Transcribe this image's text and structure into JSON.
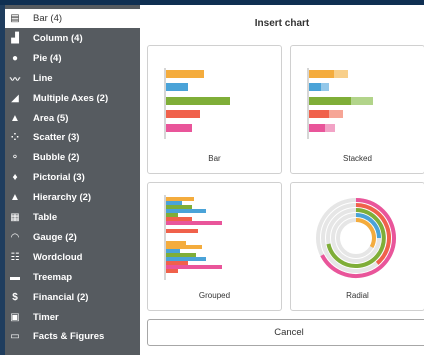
{
  "sidebar": {
    "items": [
      {
        "label": "Bar (4)",
        "icon": "bar-chart-icon",
        "glyph": "▤",
        "active": true
      },
      {
        "label": "Column (4)",
        "icon": "column-chart-icon",
        "glyph": "▟",
        "active": false
      },
      {
        "label": "Pie (4)",
        "icon": "pie-chart-icon",
        "glyph": "●",
        "active": false
      },
      {
        "label": "Line",
        "icon": "line-chart-icon",
        "glyph": "〰",
        "active": false
      },
      {
        "label": "Multiple Axes (2)",
        "icon": "multiple-axes-icon",
        "glyph": "◢",
        "active": false
      },
      {
        "label": "Area (5)",
        "icon": "area-chart-icon",
        "glyph": "▲",
        "active": false
      },
      {
        "label": "Scatter (3)",
        "icon": "scatter-chart-icon",
        "glyph": "⁘",
        "active": false
      },
      {
        "label": "Bubble (2)",
        "icon": "bubble-chart-icon",
        "glyph": "⚬",
        "active": false
      },
      {
        "label": "Pictorial (3)",
        "icon": "pictorial-chart-icon",
        "glyph": "♦",
        "active": false
      },
      {
        "label": "Hierarchy (2)",
        "icon": "hierarchy-chart-icon",
        "glyph": "▲",
        "active": false
      },
      {
        "label": "Table",
        "icon": "table-icon",
        "glyph": "▦",
        "active": false
      },
      {
        "label": "Gauge (2)",
        "icon": "gauge-icon",
        "glyph": "◠",
        "active": false
      },
      {
        "label": "Wordcloud",
        "icon": "wordcloud-icon",
        "glyph": "☷",
        "active": false
      },
      {
        "label": "Treemap",
        "icon": "treemap-icon",
        "glyph": "▬",
        "active": false
      },
      {
        "label": "Financial (2)",
        "icon": "financial-icon",
        "glyph": "$",
        "active": false
      },
      {
        "label": "Timer",
        "icon": "timer-icon",
        "glyph": "▣",
        "active": false
      },
      {
        "label": "Facts & Figures",
        "icon": "facts-figures-icon",
        "glyph": "▭",
        "active": false
      }
    ]
  },
  "dialog": {
    "title": "Insert chart",
    "cancel_label": "Cancel"
  },
  "options": [
    {
      "label": "Bar"
    },
    {
      "label": "Stacked"
    },
    {
      "label": "Grouped"
    },
    {
      "label": "Radial"
    }
  ],
  "colors": {
    "orange": "#f4ac3d",
    "blue": "#4aa3d8",
    "green": "#7fae38",
    "red": "#f0614b",
    "pink": "#e9559a",
    "sidebar": "#565b60",
    "frame": "#1f3d5e"
  }
}
